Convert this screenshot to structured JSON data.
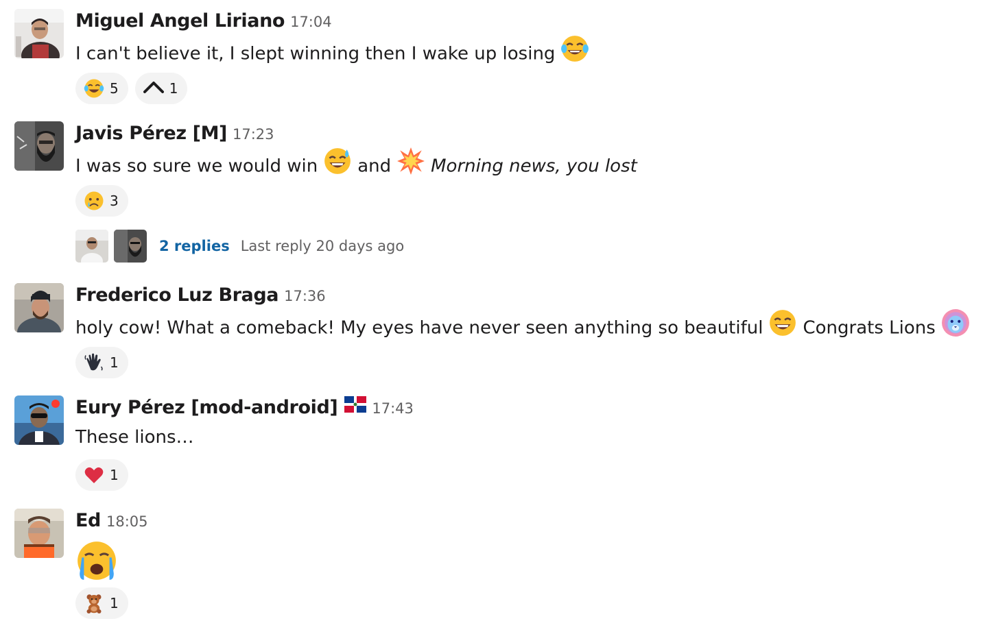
{
  "messages": [
    {
      "name": "Miguel Angel Liriano",
      "time": "17:04",
      "text_1": "I can't believe it, I slept winning then I wake up losing",
      "reactions": [
        {
          "emoji": "joy",
          "count": "5"
        },
        {
          "emoji": "caret-up",
          "count": "1"
        }
      ]
    },
    {
      "name": "Javis Pérez [M]",
      "time": "17:23",
      "text_1": "I was so sure we would win",
      "text_2": "and",
      "text_3": "Morning news, you lost",
      "reactions": [
        {
          "emoji": "cry",
          "count": "3"
        }
      ],
      "thread": {
        "replies": "2 replies",
        "last_reply": "Last reply 20 days ago"
      }
    },
    {
      "name": "Frederico Luz Braga",
      "time": "17:36",
      "text_1": "holy cow! What a comeback! My eyes have never seen anything so beautiful",
      "text_2": "Congrats Lions",
      "reactions": [
        {
          "emoji": "wave",
          "count": "1"
        }
      ]
    },
    {
      "name": "Eury Pérez [mod-android]",
      "time": "17:43",
      "text_1": "These lions…",
      "reactions": [
        {
          "emoji": "heart",
          "count": "1"
        }
      ]
    },
    {
      "name": "Ed",
      "time": "18:05",
      "reactions": [
        {
          "emoji": "teddy-bear",
          "count": "1"
        }
      ]
    }
  ],
  "colors": {
    "link": "#1264a3",
    "timestamp": "#616061",
    "reaction_bg": "#f3f3f3",
    "text": "#1d1c1d"
  }
}
